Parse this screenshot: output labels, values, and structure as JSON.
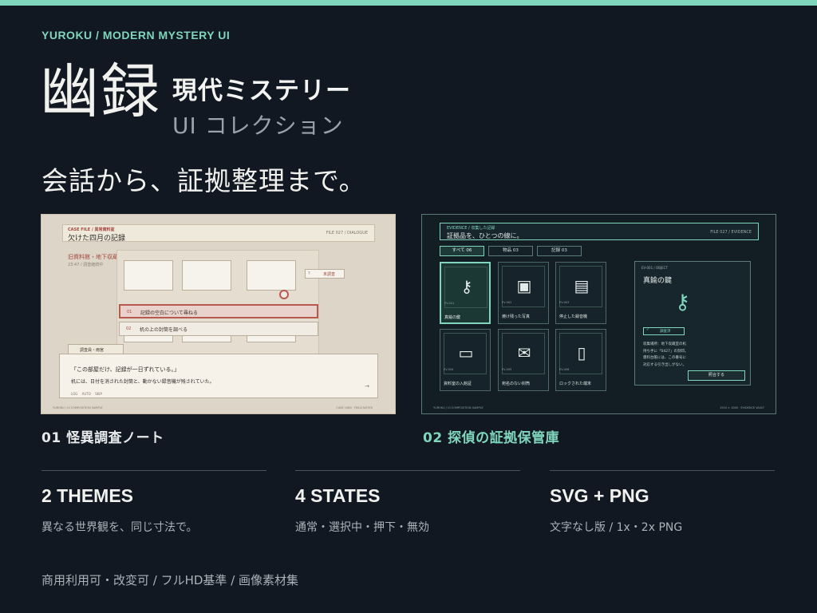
{
  "brand": "YUROKU / MODERN MYSTERY UI",
  "logo": "幽録",
  "subtitle_1": "現代ミステリー",
  "subtitle_2": "UI コレクション",
  "tagline": "会話から、証拠整理まで。",
  "colors": {
    "background": "#111821",
    "accent": "#7fd6bd",
    "light_panel": "#ddd6c8",
    "dark_panel": "#131d24",
    "crimson": "#a4473d"
  },
  "light_panel": {
    "kicker": "CASE FILE / 異常資料室",
    "title": "欠けた四月の記録",
    "meta": "FILE 027 / DIALOGUE",
    "location": "旧資料館・地下収蔵室",
    "time": "23:47 / 調査継続中",
    "tag_mark": "?",
    "tag": "未調査",
    "choices": [
      {
        "num": "01",
        "label": "記録の空白について尋ねる"
      },
      {
        "num": "02",
        "label": "机の上の封筒を調べる"
      }
    ],
    "speaker": "調査員・雨宮",
    "line1": "「この部屋だけ、記録が一日ずれている。」",
    "line2": "机には、日付を消された封筒と、動かない録音機が残されていた。",
    "controls": "LOG AUTO SKIP",
    "arrow": "→",
    "footer_left": "YUROKU / UI COMPOSITION SAMPLE",
    "footer_right": "CASE 1080 · FIELD NOTES"
  },
  "dark_panel": {
    "kicker": "EVIDENCE / 収集した記録",
    "title": "証拠品を、ひとつの線に。",
    "meta": "FILE 027 / EVIDENCE",
    "tabs": [
      "すべて 06",
      "物品 03",
      "記録 03"
    ],
    "items": [
      {
        "icon": "key-icon",
        "glyph": "⚷",
        "code": "EV-001",
        "name": "真鍮の鍵"
      },
      {
        "icon": "photo-icon",
        "glyph": "▣",
        "code": "EV-002",
        "name": "焼け残った写真"
      },
      {
        "icon": "recorder-icon",
        "glyph": "▤",
        "code": "EV-003",
        "name": "停止した録音機"
      },
      {
        "icon": "id-card-icon",
        "glyph": "▭",
        "code": "EV-004",
        "name": "資料室の入館証"
      },
      {
        "icon": "envelope-icon",
        "glyph": "✉",
        "code": "EV-005",
        "name": "宛名のない封筒"
      },
      {
        "icon": "phone-icon",
        "glyph": "▯",
        "code": "EV-006",
        "name": "ロックされた端末"
      }
    ],
    "detail": {
      "header": "EV-001 / OBJECT",
      "title": "真鍮の鍵",
      "badge": "調査済",
      "check": "✓",
      "desc": [
        "収集場所：地下収蔵室の机",
        "持ち手に「0427」の刻印。",
        "資料台帳には、この番号に",
        "対応する引き出しがない。"
      ],
      "button": "照合する"
    },
    "footer_left": "YUROKU / UI COMPOSITION SAMPLE",
    "footer_right": "1920 × 1080 · EVIDENCE VAULT"
  },
  "captions": [
    "01 怪異調査ノート",
    "02 探偵の証拠保管庫"
  ],
  "features": [
    {
      "title": "2 THEMES",
      "sub": "異なる世界観を、同じ寸法で。"
    },
    {
      "title": "4 STATES",
      "sub": "通常・選択中・押下・無効"
    },
    {
      "title": "SVG + PNG",
      "sub": "文字なし版 / 1x・2x PNG"
    }
  ],
  "footer": "商用利用可・改変可 / フルHD基準 / 画像素材集"
}
